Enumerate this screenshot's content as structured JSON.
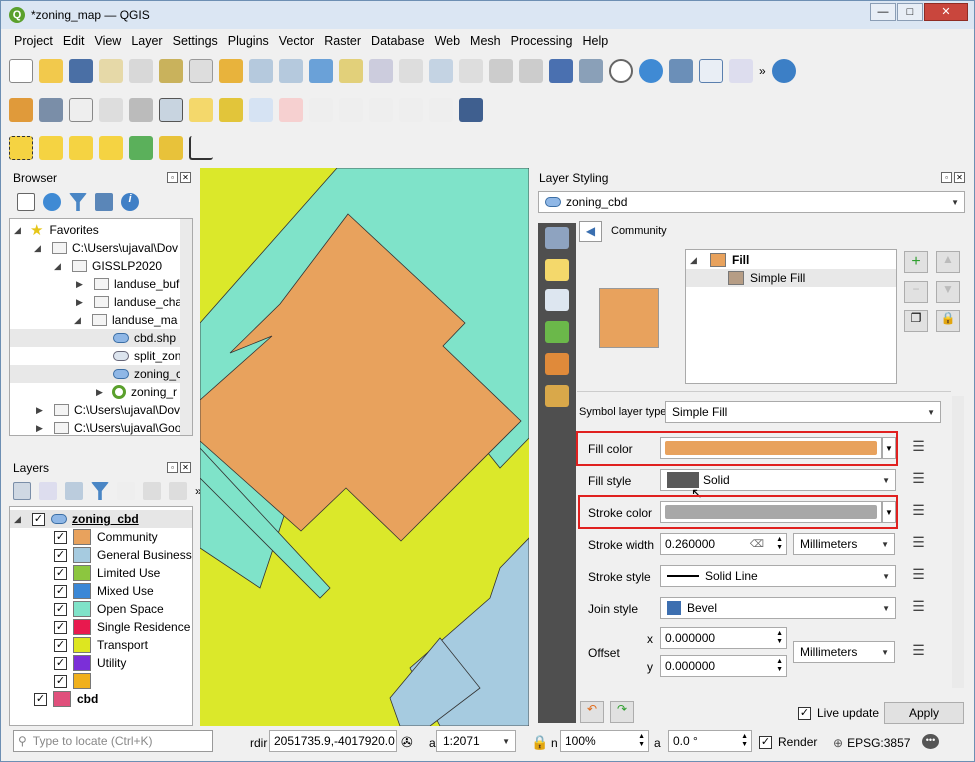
{
  "window": {
    "title": "*zoning_map — QGIS",
    "minimize": "—",
    "maximize": "□",
    "close": "✕"
  },
  "menu": [
    "Project",
    "Edit",
    "View",
    "Layer",
    "Settings",
    "Plugins",
    "Vector",
    "Raster",
    "Database",
    "Web",
    "Mesh",
    "Processing",
    "Help"
  ],
  "toolbar": {
    "overflow": "»"
  },
  "browser": {
    "title": "Browser",
    "items": [
      {
        "label": "Favorites",
        "icon": "star-icon"
      },
      {
        "label": "C:\\Users\\ujaval\\Dov",
        "icon": "folder-icon"
      },
      {
        "label": "GISSLP2020",
        "icon": "folder-icon"
      },
      {
        "label": "landuse_buf",
        "icon": "folder-icon"
      },
      {
        "label": "landuse_cha",
        "icon": "folder-icon"
      },
      {
        "label": "landuse_ma",
        "icon": "folder-icon"
      },
      {
        "label": "cbd.shp",
        "icon": "polygon-layer-icon"
      },
      {
        "label": "split_zon",
        "icon": "polygon-layer-icon"
      },
      {
        "label": "zoning_c",
        "icon": "polygon-layer-icon"
      },
      {
        "label": "zoning_r",
        "icon": "qgis-project-icon"
      },
      {
        "label": "C:\\Users\\ujaval\\Dov",
        "icon": "folder-icon"
      },
      {
        "label": "C:\\Users\\ujaval\\Goo",
        "icon": "folder-icon"
      }
    ]
  },
  "layers": {
    "title": "Layers",
    "overflow": "»",
    "group": "zoning_cbd",
    "classes": [
      {
        "label": "Community",
        "color": "#e8a25d"
      },
      {
        "label": "General Business",
        "color": "#a6cbe0"
      },
      {
        "label": "Limited Use",
        "color": "#8cc63f"
      },
      {
        "label": "Mixed Use",
        "color": "#3a87d6"
      },
      {
        "label": "Open Space",
        "color": "#7fe3c9"
      },
      {
        "label": "Single Residence",
        "color": "#e8194e"
      },
      {
        "label": "Transport",
        "color": "#dde620"
      },
      {
        "label": "Utility",
        "color": "#7b2fd8"
      },
      {
        "label": "",
        "color": "#f0b01c"
      }
    ],
    "cbd": {
      "label": "cbd",
      "color": "#e0507c"
    }
  },
  "styling": {
    "title": "Layer Styling",
    "layer": "zoning_cbd",
    "category": "Community",
    "tree": {
      "fill": "Fill",
      "simple_fill": "Simple Fill"
    },
    "symbol_layer_type_label": "Symbol layer type",
    "symbol_layer_type": "Simple Fill",
    "fill_color_label": "Fill color",
    "fill_color": "#e8a25d",
    "fill_style_label": "Fill style",
    "fill_style": "Solid",
    "stroke_color_label": "Stroke color",
    "stroke_color": "#a8a8a8",
    "stroke_width_label": "Stroke width",
    "stroke_width": "0.260000",
    "stroke_width_unit": "Millimeters",
    "stroke_style_label": "Stroke style",
    "stroke_style": "Solid Line",
    "join_style_label": "Join style",
    "join_style": "Bevel",
    "offset_label": "Offset",
    "offset_x_label": "x",
    "offset_x": "0.000000",
    "offset_y_label": "y",
    "offset_y": "0.000000",
    "offset_unit": "Millimeters",
    "live_update": "Live update",
    "apply": "Apply"
  },
  "status": {
    "locate_placeholder": "Type to locate (Ctrl+K)",
    "coord_label": "rdir",
    "coordinate": "2051735.9,-4017920.0",
    "scale_label": "a",
    "scale": "1:2071",
    "mag_label": "n",
    "magnifier": "100%",
    "rot_label": "a",
    "rotation": "0.0 °",
    "render": "Render",
    "crs": "EPSG:3857"
  }
}
